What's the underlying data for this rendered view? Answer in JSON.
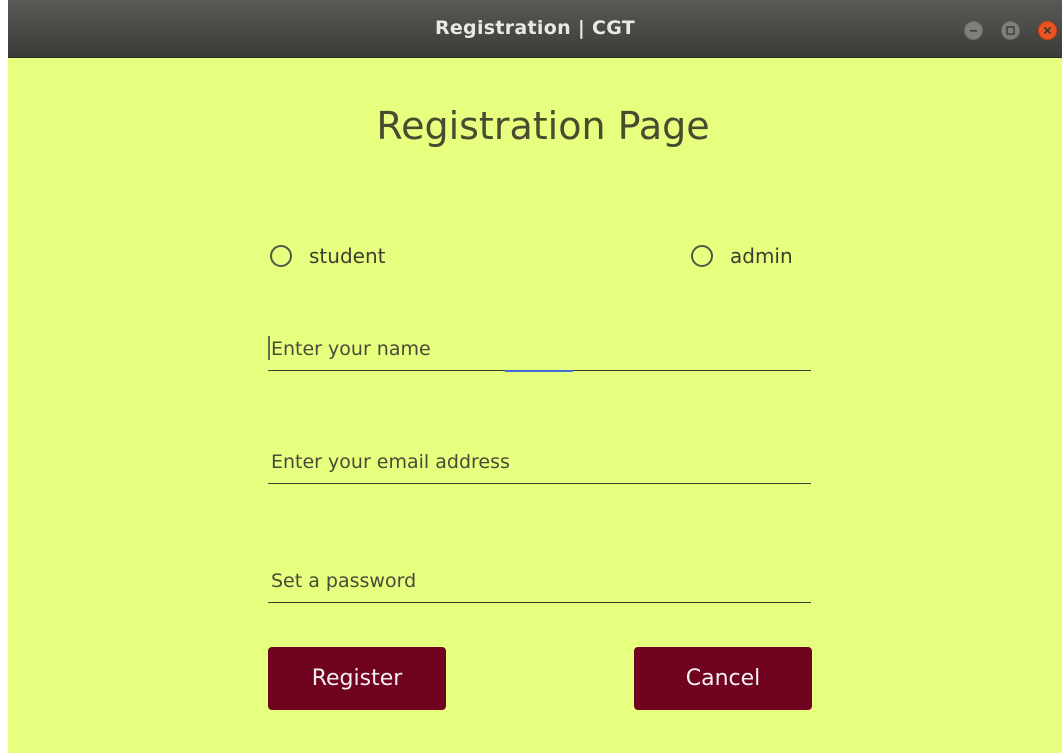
{
  "window": {
    "title": "Registration | CGT",
    "controls": {
      "minimize_icon": "minimize-icon",
      "maximize_icon": "maximize-icon",
      "close_icon": "close-icon"
    }
  },
  "page": {
    "heading": "Registration Page",
    "background_color": "#e6ff7f"
  },
  "role": {
    "options": [
      {
        "label": "student",
        "selected": false
      },
      {
        "label": "admin",
        "selected": false
      }
    ]
  },
  "form": {
    "name": {
      "value": "",
      "placeholder": "Enter your name",
      "focused": true
    },
    "email": {
      "value": "",
      "placeholder": "Enter your email address"
    },
    "password": {
      "value": "",
      "placeholder": "Set a password"
    }
  },
  "actions": {
    "register_label": "Register",
    "cancel_label": "Cancel",
    "button_color": "#6f0320",
    "focus_color": "#3f6fd8"
  }
}
